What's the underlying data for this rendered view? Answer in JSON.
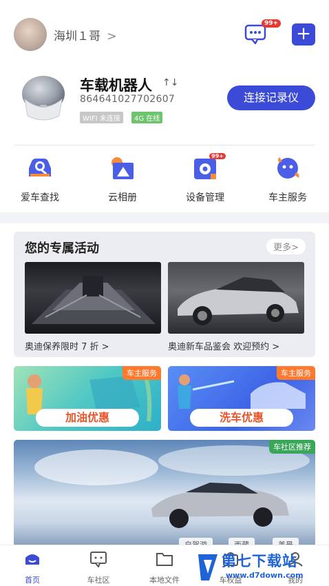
{
  "header": {
    "user_name": "海圳１哥",
    "chevron": ">",
    "message_badge": "99+",
    "add_icon": "+"
  },
  "device": {
    "name": "车载机器人",
    "signal_icon": "↑↓",
    "id": "864641027702607",
    "wifi_status": "WIFI 未连接",
    "network_status": "4G 在线",
    "connect_button": "连接记录仪"
  },
  "quicknav": [
    {
      "label": "爱车查找",
      "icon": "car-search-icon"
    },
    {
      "label": "云相册",
      "icon": "cloud-album-icon"
    },
    {
      "label": "设备管理",
      "icon": "device-manage-icon",
      "badge": "99+"
    },
    {
      "label": "车主服务",
      "icon": "owner-service-icon"
    }
  ],
  "activity": {
    "title": "您的专属活动",
    "more": "更多>",
    "items": [
      {
        "caption": "奥迪保养限时 7 折 >"
      },
      {
        "caption": "奥迪新车品鉴会 欢迎预约 >"
      }
    ]
  },
  "promos": [
    {
      "tag": "车主服务",
      "button": "加油优惠"
    },
    {
      "tag": "车主服务",
      "button": "洗车优惠"
    }
  ],
  "banner": {
    "tag": "车社区推荐",
    "chips": [
      "自驾游",
      "西藏",
      "美景"
    ]
  },
  "tabbar": [
    {
      "label": "首页",
      "icon": "home-icon",
      "active": true
    },
    {
      "label": "车社区",
      "icon": "community-icon",
      "active": false
    },
    {
      "label": "本地文件",
      "icon": "folder-icon",
      "active": false
    },
    {
      "label": "车权益",
      "icon": "benefit-icon",
      "active": false
    },
    {
      "label": "我的",
      "icon": "profile-icon",
      "active": false
    }
  ],
  "watermark": {
    "title": "第七下载站",
    "url": "www.d7down.com"
  },
  "colors": {
    "primary": "#3b4bd8",
    "badge": "#e53935",
    "orange": "#ff7a2e",
    "green": "#3aa657"
  }
}
